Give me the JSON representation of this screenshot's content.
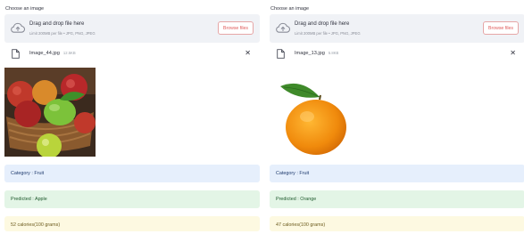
{
  "panels": [
    {
      "choose_label": "Choose an image",
      "dropzone": {
        "title": "Drag and drop file here",
        "subtitle": "Limit 200MB per file • JPG, PNG, JPEG",
        "browse_label": "Browse files",
        "icon": "cloud-upload-icon"
      },
      "file": {
        "name": "Image_44.jpg",
        "size": "12.5KB",
        "icon": "file-icon"
      },
      "image": {
        "subject": "fruit basket with apples"
      },
      "category_text": "Category : Fruit",
      "predicted_text": "Predicted : Apple",
      "calories_text": "52 calories(100 grams)"
    },
    {
      "choose_label": "Choose an image",
      "dropzone": {
        "title": "Drag and drop file here",
        "subtitle": "Limit 200MB per file • JPG, PNG, JPEG",
        "browse_label": "Browse files",
        "icon": "cloud-upload-icon"
      },
      "file": {
        "name": "Image_13.jpg",
        "size": "5.8KB",
        "icon": "file-icon"
      },
      "image": {
        "subject": "orange with leaf"
      },
      "category_text": "Category : Fruit",
      "predicted_text": "Predicted : Orange",
      "calories_text": "47 calories(100 grams)"
    }
  ],
  "colors": {
    "dropzone_bg": "#f0f2f6",
    "browse_border": "#e6a6a6",
    "browse_text": "#e05b5b",
    "category_bg": "#e6effc",
    "predicted_bg": "#e3f5e6",
    "calories_bg": "#fdf9e1"
  }
}
